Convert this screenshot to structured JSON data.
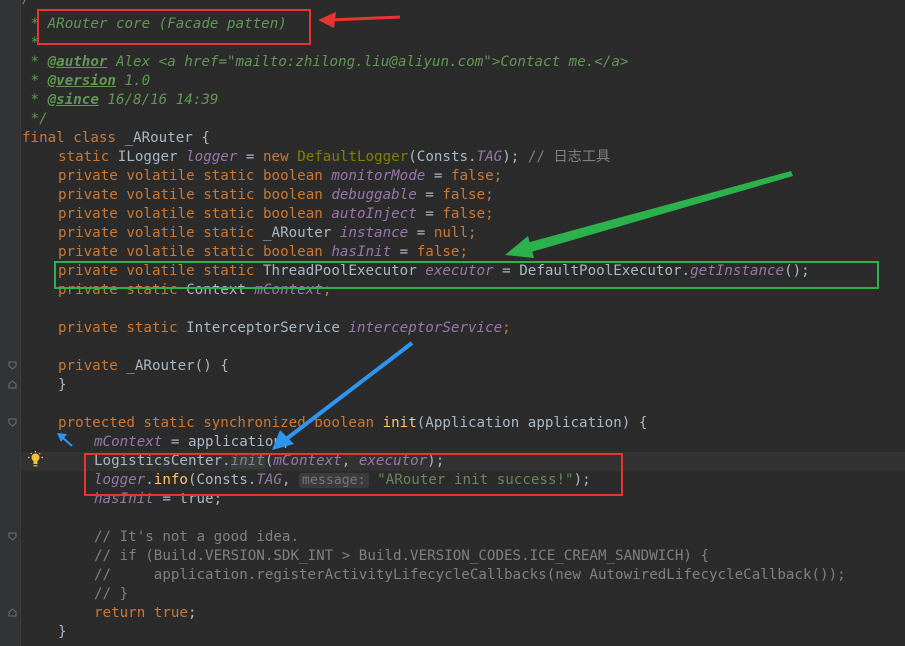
{
  "editor": {
    "colors": {
      "background": "#2b2b2b",
      "keyword": "#cc7832",
      "comment": "#808080",
      "javadoc": "#629755",
      "field": "#9876aa",
      "method": "#ffc66d",
      "string": "#6a8759",
      "text": "#a9b7c6",
      "annotation_red": "#e8352f",
      "annotation_green": "#2bb24c",
      "annotation_blue": "#2d96f0"
    },
    "lines": {
      "l0": "/**",
      "l1_star": " * ",
      "l1": "ARouter core (Facade patten)",
      "l2": " *",
      "l3_tag": "@author",
      "l3": " Alex <a href=\"mailto:zhilong.liu@aliyun.com\">Contact me.</a>",
      "l4_tag": "@version",
      "l4": " 1.0",
      "l5_tag": "@since",
      "l5": " 16/8/16 14:39",
      "l6": " */",
      "l7_kw": "final class ",
      "l7": "_ARouter {",
      "l8_kw": "static ",
      "l8_type": "ILogger ",
      "l8_field": "logger",
      "l8_eq": " = ",
      "l8_new": "new ",
      "l8_cls": "DefaultLogger",
      "l8_args1": "(Consts.",
      "l8_tag": "TAG",
      "l8_args2": "); ",
      "l8_comment": "// 日志工具",
      "l9_kw": "private volatile static boolean ",
      "l9_field": "monitorMode",
      "l9_eq": " = ",
      "l9_val": "false",
      "l10_kw": "private volatile static boolean ",
      "l10_field": "debuggable",
      "l10_eq": " = ",
      "l10_val": "false",
      "l11_kw": "private volatile static boolean ",
      "l11_field": "autoInject",
      "l11_eq": " = ",
      "l11_val": "false",
      "l12_kw": "private volatile static ",
      "l12_type": "_ARouter ",
      "l12_field": "instance",
      "l12_eq": " = ",
      "l12_val": "null",
      "l13_kw": "private volatile static boolean ",
      "l13_field": "hasInit",
      "l13_eq": " = ",
      "l13_val": "false",
      "l14_kw": "private volatile static ",
      "l14_type": "ThreadPoolExecutor ",
      "l14_field": "executor",
      "l14_eq": " = DefaultPoolExecutor.",
      "l14_call": "getInstance",
      "l14_end": "();",
      "l15_kw": "private static ",
      "l15_type": "Context ",
      "l15_field": "mContext",
      "l16_kw": "private static ",
      "l16_type": "InterceptorService ",
      "l16_field": "interceptorService",
      "l17_kw": "private ",
      "l17": "_ARouter() {",
      "l18": "}",
      "l19_kw": "protected static synchronized boolean ",
      "l19_fn": "init",
      "l19_rest": "(Application application) {",
      "l20_field": "mContext",
      "l20_rest": " = application;",
      "l21_cls": "LogisticsCenter.",
      "l21_call": "init",
      "l21_p1": "(",
      "l21_a1": "mContext",
      "l21_c": ", ",
      "l21_a2": "executor",
      "l21_end": ");",
      "l22_field": "logger",
      "l22_dot": ".",
      "l22_call": "info",
      "l22_p": "(Consts.",
      "l22_tag": "TAG",
      "l22_c": ", ",
      "l22_hint": "message:",
      "l22_str": "\"ARouter init success!\"",
      "l22_end": ");",
      "l23_field": "hasInit",
      "l23_rest": " = true;",
      "l24": "// It's not a good idea.",
      "l25": "// if (Build.VERSION.SDK_INT > Build.VERSION_CODES.ICE_CREAM_SANDWICH) {",
      "l26": "//     application.registerActivityLifecycleCallbacks(new AutowiredLifecycleCallback());",
      "l27": "// }",
      "l28_kw": "return ",
      "l28_val": "true",
      "l28_end": ";",
      "l29": "}"
    }
  }
}
